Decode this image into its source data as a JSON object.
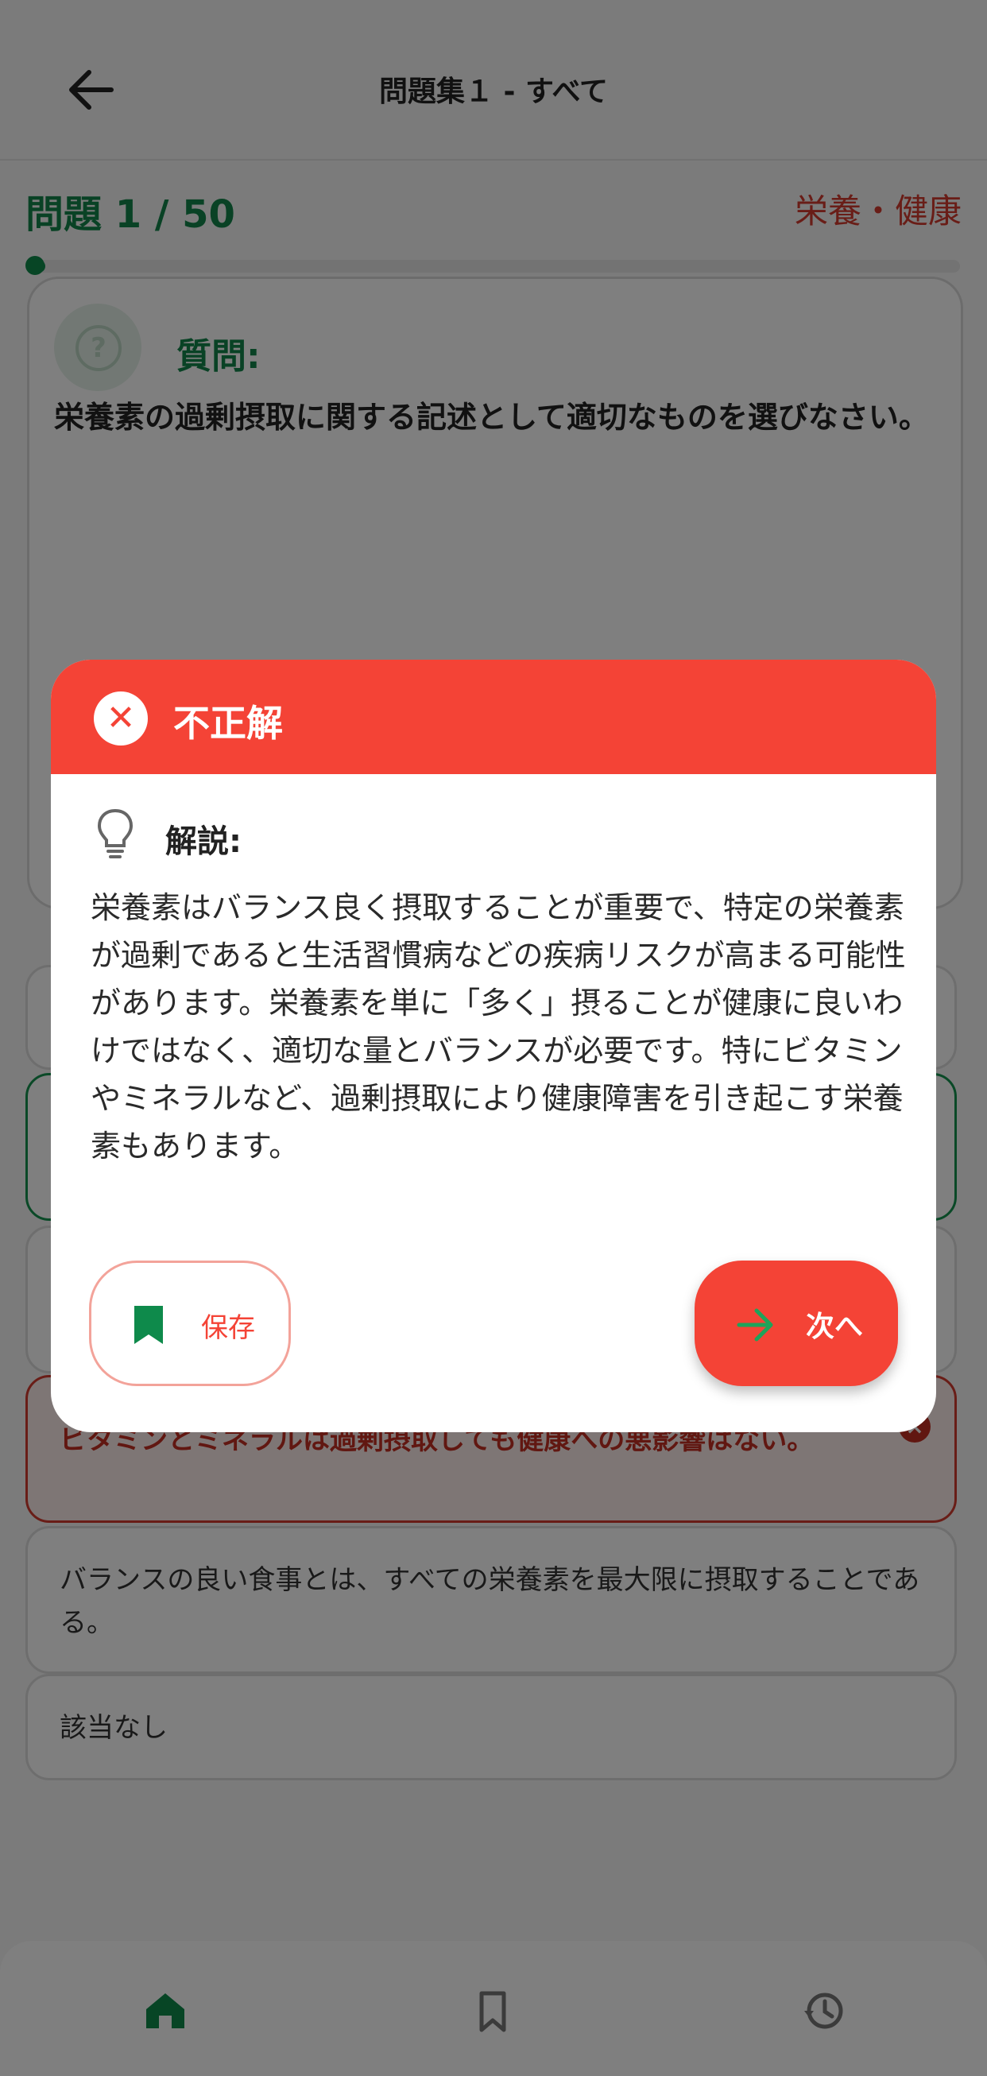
{
  "header": {
    "title": "問題集１ - すべて"
  },
  "question": {
    "counter": "問題 1 / 50",
    "category": "栄養・健康",
    "progress_fraction": 0.02,
    "label": "質問:",
    "text": "栄養素の過剰摂取に関する記述として適切なものを選びなさい。"
  },
  "options": [
    {
      "text": ""
    },
    {
      "text": ""
    },
    {
      "text": ""
    },
    {
      "text": "ビタミンとミネラルは過剰摂取しても健康への悪影響はない。"
    },
    {
      "text": "バランスの良い食事とは、すべての栄養素を最大限に摂取することである。"
    },
    {
      "text": "該当なし"
    }
  ],
  "modal": {
    "title": "不正解",
    "explanation_label": "解説:",
    "explanation": "栄養素はバランス良く摂取することが重要で、特定の栄養素が過剰であると生活習慣病などの疾病リスクが高まる可能性があります。栄養素を単に「多く」摂ることが健康に良いわけではなく、適切な量とバランスが必要です。特にビタミンやミネラルなど、過剰摂取により健康障害を引き起こす栄養素もあります。",
    "save_label": "保存",
    "next_label": "次へ"
  },
  "colors": {
    "accent_green": "#12854a",
    "error_red": "#f44336",
    "category_red": "#d23b2e"
  },
  "nav": {
    "icons": [
      "home-icon",
      "bookmark-icon",
      "history-icon"
    ]
  }
}
